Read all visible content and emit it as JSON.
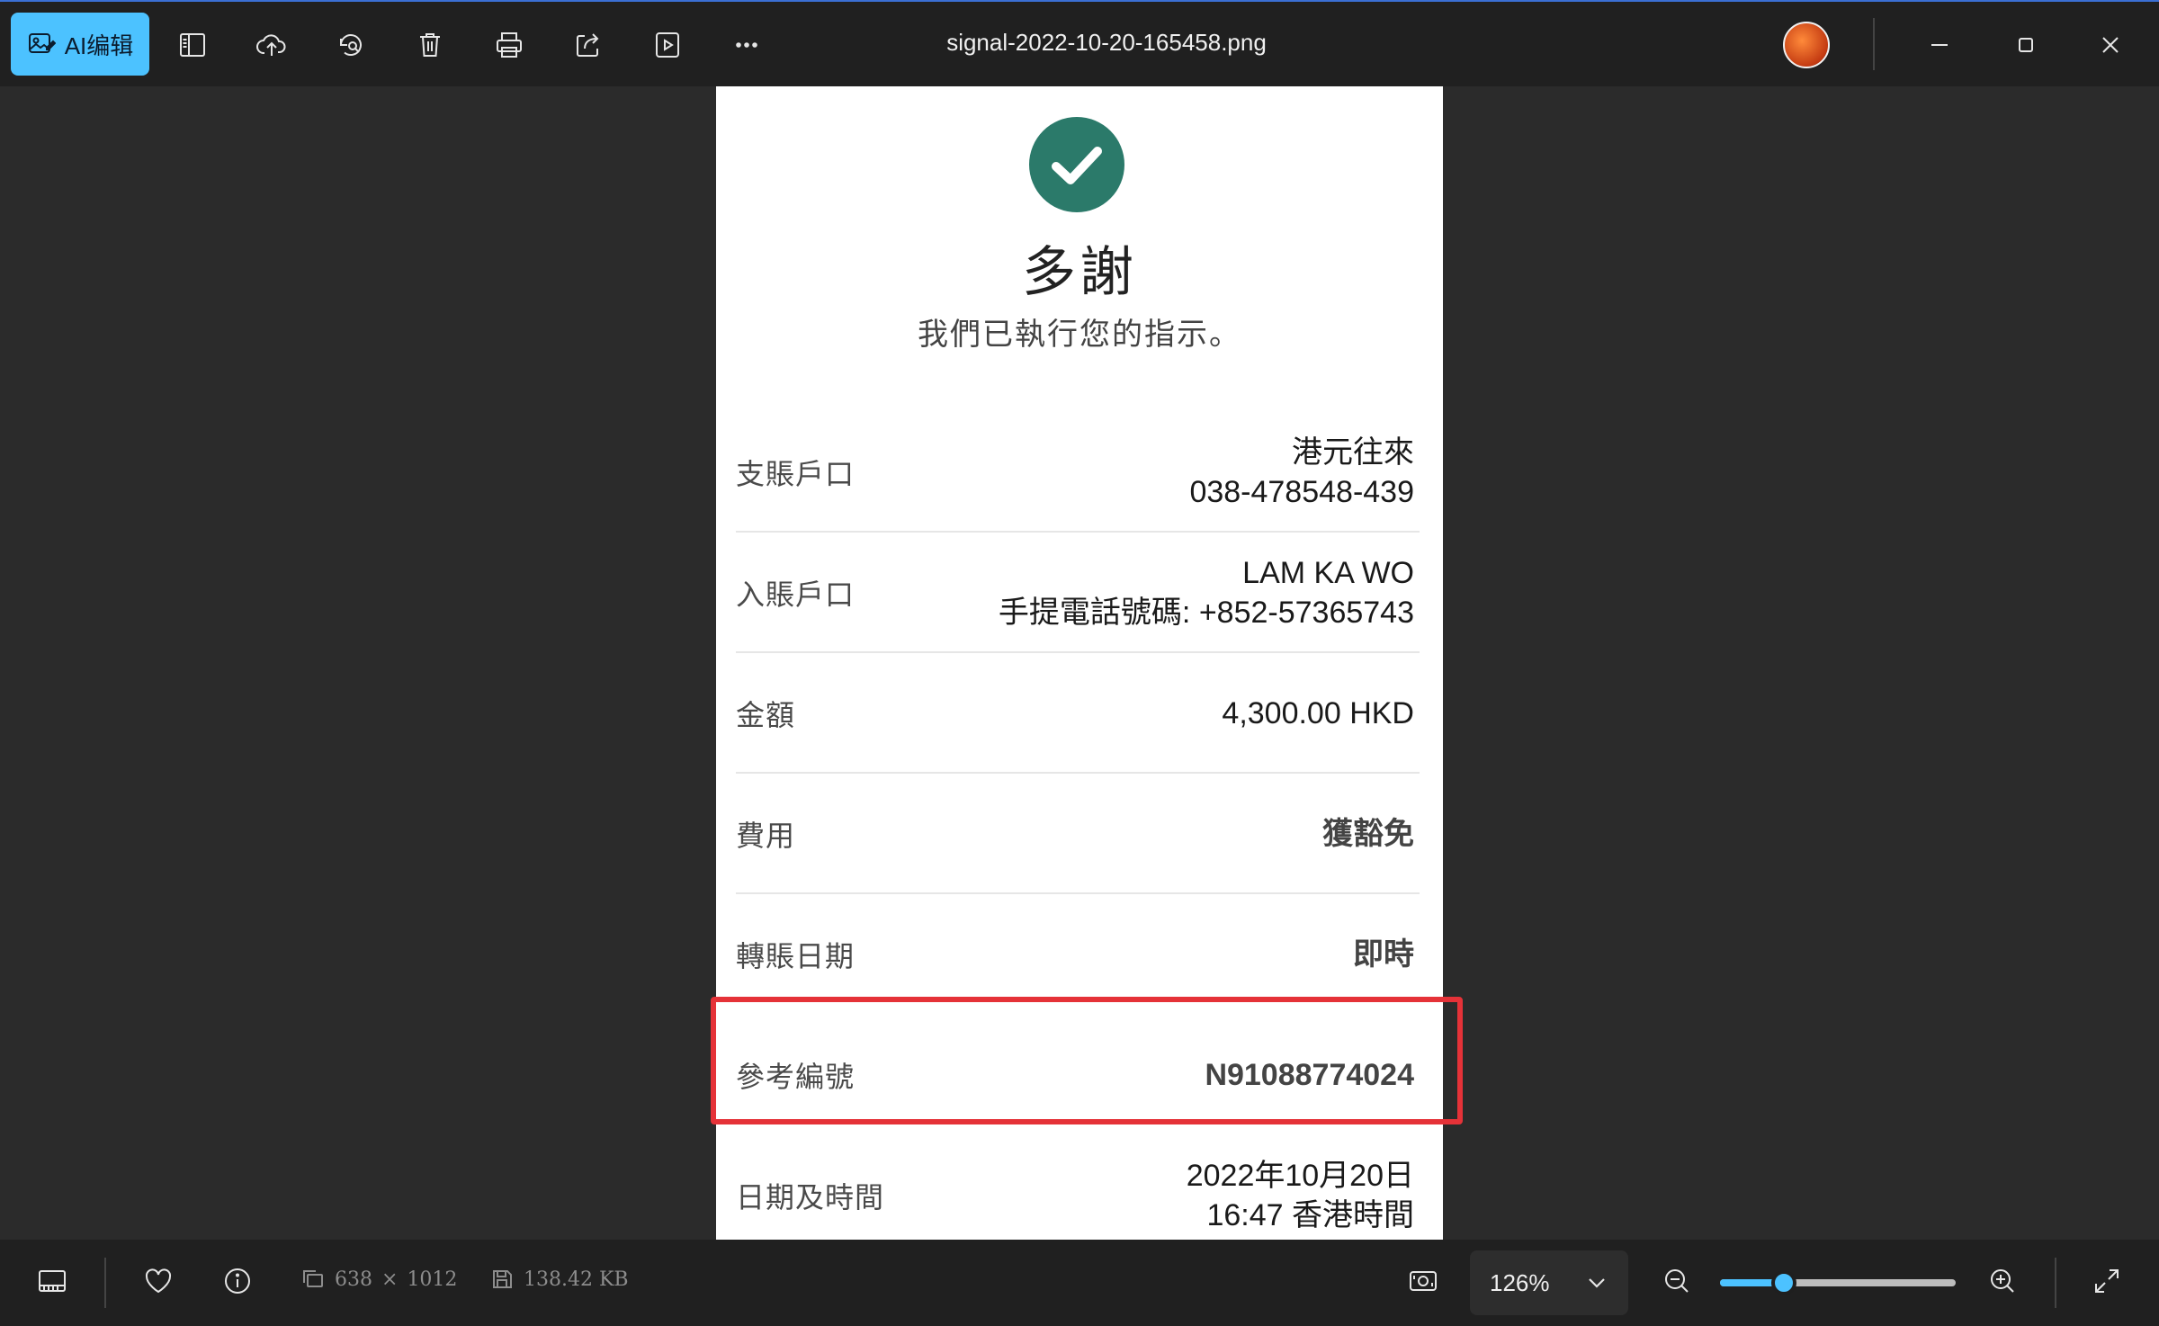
{
  "toolbar": {
    "ai_edit_label": "AI编辑",
    "file_name": "signal-2022-10-20-165458.png",
    "icons": [
      "sidebar-panel-icon",
      "cloud-upload-icon",
      "rotate-search-icon",
      "delete-icon",
      "print-icon",
      "share-icon",
      "slideshow-icon",
      "more-icon"
    ]
  },
  "receipt": {
    "heading": "多謝",
    "subheading": "我們已執行您的指示。",
    "rows": [
      {
        "label": "支賬戶口",
        "value_line1": "港元往來",
        "value_line2": "038-478548-439"
      },
      {
        "label": "入賬戶口",
        "value_line1": "LAM KA WO",
        "value_line2": "手提電話號碼: +852-57365743"
      },
      {
        "label": "金額",
        "value_line1": "4,300.00 HKD",
        "value_line2": ""
      },
      {
        "label": "費用",
        "value_line1": "獲豁免",
        "value_line2": ""
      },
      {
        "label": "轉賬日期",
        "value_line1": "即時",
        "value_line2": ""
      },
      {
        "label": "參考編號",
        "value_line1": "N91088774024",
        "value_line2": ""
      },
      {
        "label": "日期及時間",
        "value_line1": "2022年10月20日",
        "value_line2": "16:47 香港時間"
      }
    ],
    "highlight_color": "#e53238",
    "check_color": "#2b7a6a"
  },
  "statusbar": {
    "width": "638",
    "times": "×",
    "height": "1012",
    "file_size": "138.42 KB",
    "zoom": "126%",
    "zoom_slider_fraction": 0.27
  },
  "colors": {
    "accent": "#4cc2ff",
    "background": "#2b2b2b",
    "bar": "#202020"
  }
}
